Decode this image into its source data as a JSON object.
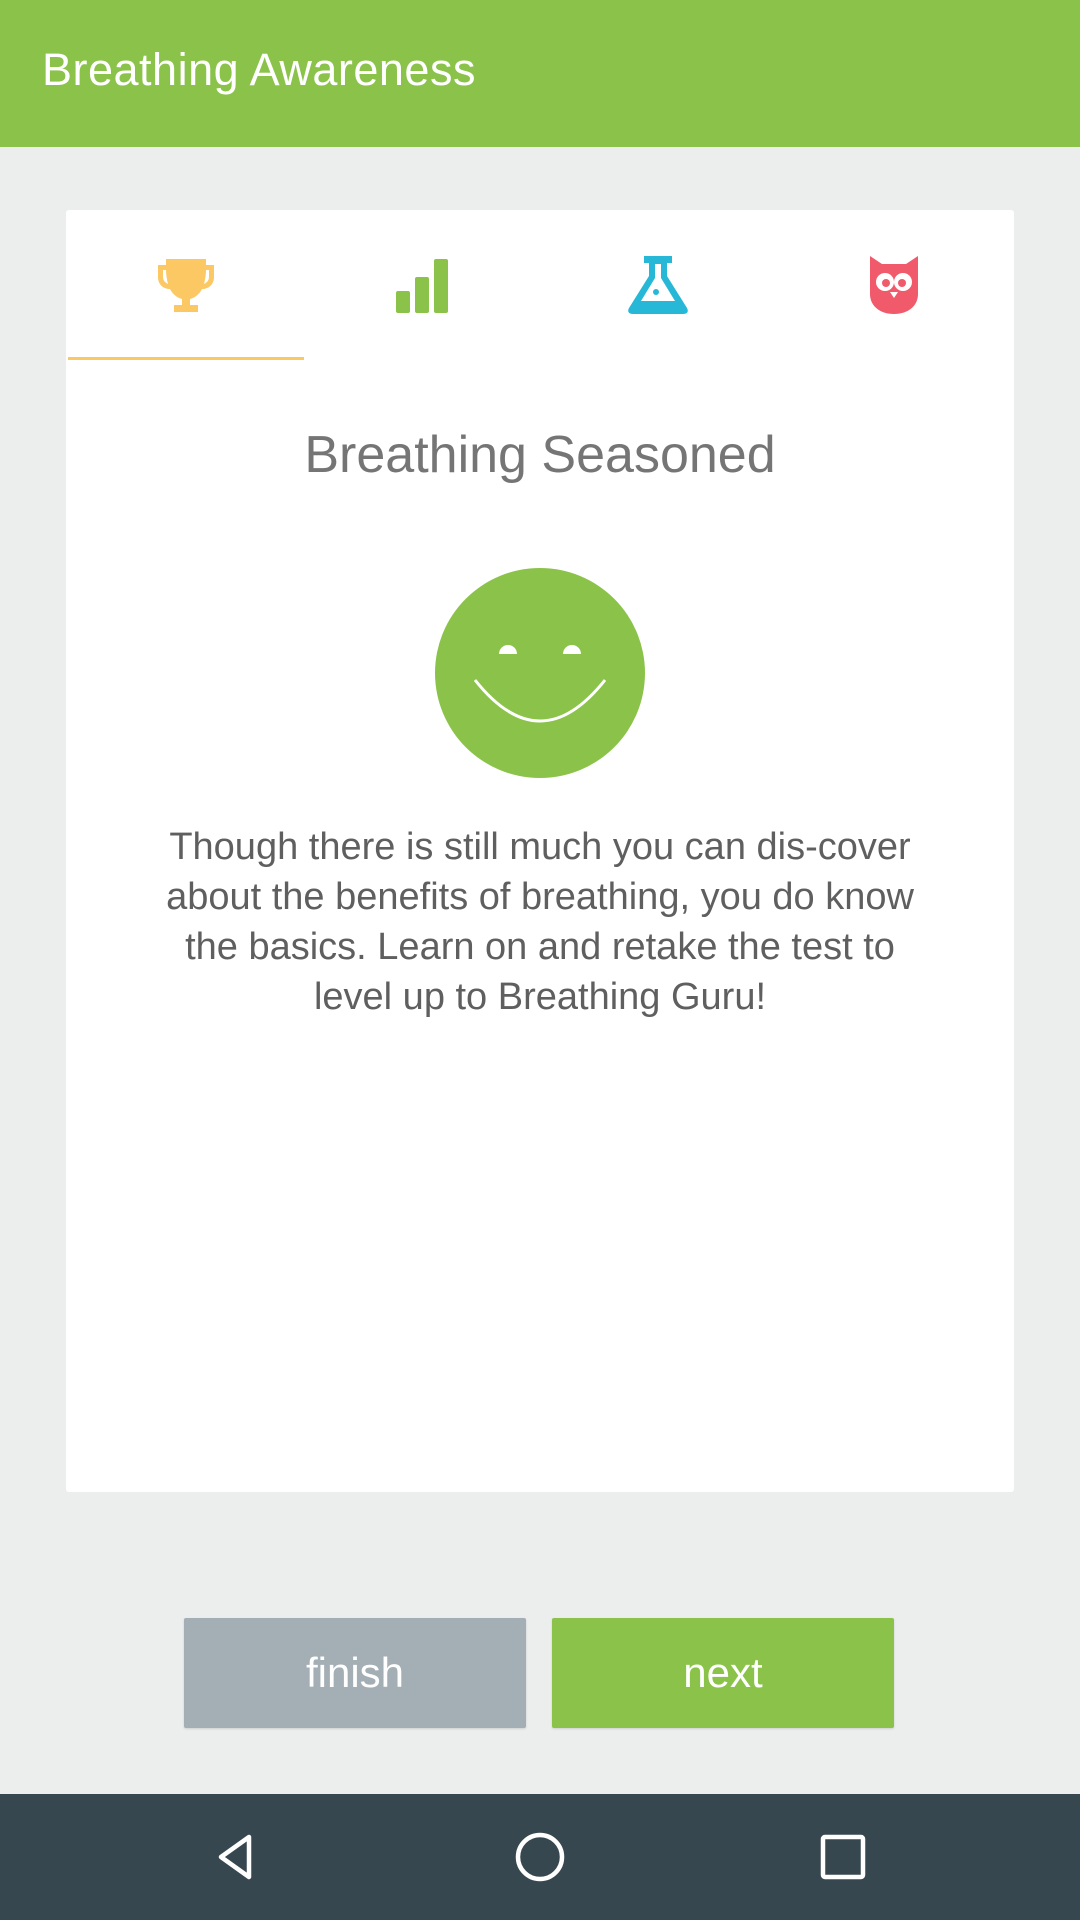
{
  "app": {
    "title": "Breathing Awareness"
  },
  "tabs": [
    {
      "icon": "trophy-icon",
      "color": "#fcc864",
      "active": true
    },
    {
      "icon": "bar-chart-icon",
      "color": "#8bc34a",
      "active": false
    },
    {
      "icon": "flask-icon",
      "color": "#26b8d6",
      "active": false
    },
    {
      "icon": "owl-icon",
      "color": "#f05a6a",
      "active": false
    }
  ],
  "result": {
    "level_title": "Breathing Seasoned",
    "face_icon": "smiley-face-icon",
    "face_color": "#8bc34a",
    "message": "Though there is still much you can dis-cover about the benefits of breathing, you do know the basics. Learn on and retake the test to level up to Breathing Guru!"
  },
  "buttons": {
    "finish_label": "finish",
    "next_label": "next",
    "finish_color": "#a3aeb5",
    "next_color": "#8bc34a"
  },
  "navbar": {
    "icons": [
      "back-triangle-icon",
      "home-circle-icon",
      "recents-square-icon"
    ]
  },
  "colors": {
    "appbar": "#8bc34a",
    "background": "#eceeee",
    "navbar": "#37474f"
  }
}
